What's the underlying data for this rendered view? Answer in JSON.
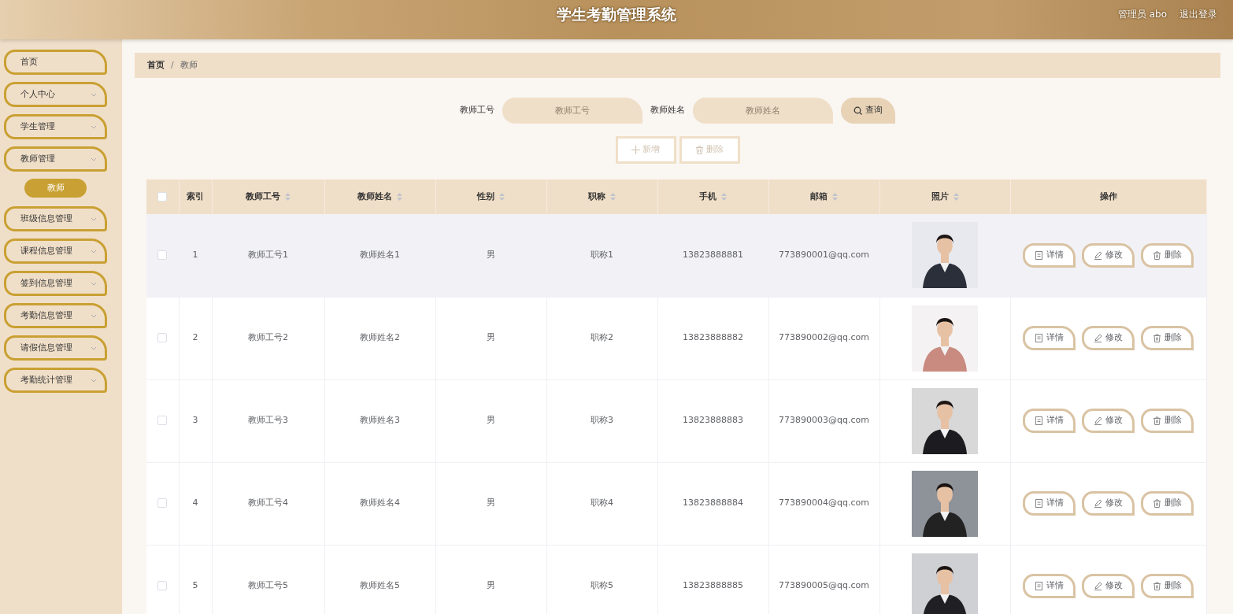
{
  "header": {
    "title": "学生考勤管理系统",
    "user": "管理员 abo",
    "logout": "退出登录"
  },
  "sidebar": {
    "items": [
      {
        "label": "首页",
        "kind": "link"
      },
      {
        "label": "个人中心",
        "kind": "menu"
      },
      {
        "label": "学生管理",
        "kind": "menu"
      },
      {
        "label": "教师管理",
        "kind": "menu",
        "children": [
          {
            "label": "教师",
            "selected": true
          }
        ]
      },
      {
        "label": "班级信息管理",
        "kind": "menu"
      },
      {
        "label": "课程信息管理",
        "kind": "menu"
      },
      {
        "label": "签到信息管理",
        "kind": "menu"
      },
      {
        "label": "考勤信息管理",
        "kind": "menu"
      },
      {
        "label": "请假信息管理",
        "kind": "menu"
      },
      {
        "label": "考勤统计管理",
        "kind": "menu"
      }
    ]
  },
  "breadcrumb": {
    "items": [
      "首页",
      "教师"
    ],
    "separator": "/"
  },
  "search": {
    "fields": [
      {
        "label": "教师工号",
        "placeholder": "教师工号"
      },
      {
        "label": "教师姓名",
        "placeholder": "教师姓名"
      }
    ],
    "button": "查询"
  },
  "actions": [
    {
      "label": "新增",
      "kind": "add"
    },
    {
      "label": "删除",
      "kind": "delete"
    }
  ],
  "table": {
    "select_all": false,
    "columns": [
      {
        "label": "索引",
        "sortable": false
      },
      {
        "label": "教师工号",
        "sortable": true
      },
      {
        "label": "教师姓名",
        "sortable": true
      },
      {
        "label": "性别",
        "sortable": true
      },
      {
        "label": "职称",
        "sortable": true
      },
      {
        "label": "手机",
        "sortable": true
      },
      {
        "label": "邮箱",
        "sortable": true
      },
      {
        "label": "照片",
        "sortable": true
      },
      {
        "label": "操作",
        "sortable": false
      }
    ],
    "rows": [
      {
        "checked": false,
        "hovered": true,
        "cells": [
          "1",
          "教师工号1",
          "教师姓名1",
          "男",
          "职称1",
          "13823888881",
          "773890001@qq.com"
        ],
        "actions": [
          {
            "label": "详情",
            "kind": "detail"
          },
          {
            "label": "修改",
            "kind": "edit"
          },
          {
            "label": "删除",
            "kind": "delete"
          }
        ]
      },
      {
        "checked": false,
        "hovered": false,
        "cells": [
          "2",
          "教师工号2",
          "教师姓名2",
          "男",
          "职称2",
          "13823888882",
          "773890002@qq.com"
        ],
        "actions": [
          {
            "label": "详情",
            "kind": "detail"
          },
          {
            "label": "修改",
            "kind": "edit"
          },
          {
            "label": "删除",
            "kind": "delete"
          }
        ]
      },
      {
        "checked": false,
        "hovered": false,
        "cells": [
          "3",
          "教师工号3",
          "教师姓名3",
          "男",
          "职称3",
          "13823888883",
          "773890003@qq.com"
        ],
        "actions": [
          {
            "label": "详情",
            "kind": "detail"
          },
          {
            "label": "修改",
            "kind": "edit"
          },
          {
            "label": "删除",
            "kind": "delete"
          }
        ]
      },
      {
        "checked": false,
        "hovered": false,
        "cells": [
          "4",
          "教师工号4",
          "教师姓名4",
          "男",
          "职称4",
          "13823888884",
          "773890004@qq.com"
        ],
        "actions": [
          {
            "label": "详情",
            "kind": "detail"
          },
          {
            "label": "修改",
            "kind": "edit"
          },
          {
            "label": "删除",
            "kind": "delete"
          }
        ]
      },
      {
        "checked": false,
        "hovered": false,
        "cells": [
          "5",
          "教师工号5",
          "教师姓名5",
          "男",
          "职称5",
          "13823888885",
          "773890005@qq.com"
        ],
        "actions": [
          {
            "label": "详情",
            "kind": "detail"
          },
          {
            "label": "修改",
            "kind": "edit"
          },
          {
            "label": "删除",
            "kind": "delete"
          }
        ]
      }
    ]
  }
}
